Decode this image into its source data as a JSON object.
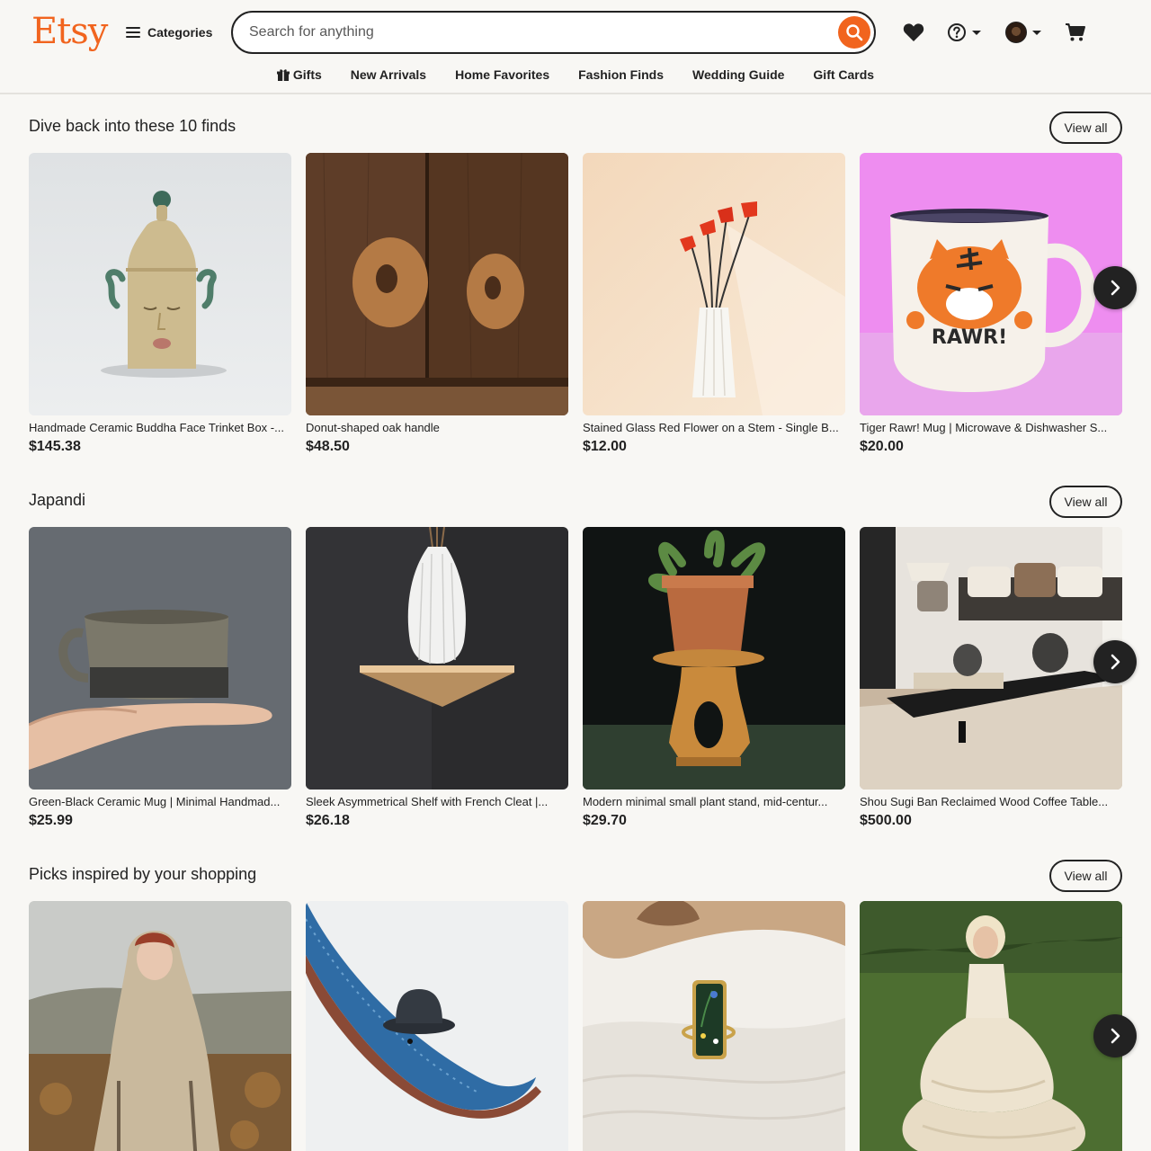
{
  "brand": {
    "logo": "Etsy",
    "accent": "#f1641e"
  },
  "header": {
    "categories_label": "Categories",
    "search_placeholder": "Search for anything"
  },
  "subnav": [
    {
      "label": "Gifts",
      "icon": "gift-icon"
    },
    {
      "label": "New Arrivals"
    },
    {
      "label": "Home Favorites"
    },
    {
      "label": "Fashion Finds"
    },
    {
      "label": "Wedding Guide"
    },
    {
      "label": "Gift Cards"
    }
  ],
  "sections": [
    {
      "title": "Dive back into these 10 finds",
      "view_all": "View all",
      "items": [
        {
          "title": "Handmade Ceramic Buddha Face Trinket Box -...",
          "price": "$145.38",
          "image": "ceramic-face-trinket-box"
        },
        {
          "title": "Donut-shaped oak handle",
          "price": "$48.50",
          "image": "donut-oak-handles"
        },
        {
          "title": "Stained Glass Red Flower on a Stem - Single B...",
          "price": "$12.00",
          "image": "red-glass-flowers-vase"
        },
        {
          "title": "Tiger Rawr! Mug | Microwave & Dishwasher S...",
          "price": "$20.00",
          "image": "tiger-rawr-mug",
          "mug_text": "RAWR!"
        }
      ]
    },
    {
      "title": "Japandi",
      "view_all": "View all",
      "items": [
        {
          "title": "Green-Black Ceramic Mug | Minimal Handmad...",
          "price": "$25.99",
          "image": "ceramic-mug-on-hand"
        },
        {
          "title": "Sleek Asymmetrical Shelf with French Cleat |...",
          "price": "$26.18",
          "image": "white-vase-on-shelf"
        },
        {
          "title": "Modern minimal small plant stand, mid-centur...",
          "price": "$29.70",
          "image": "plant-on-wood-stand"
        },
        {
          "title": "Shou Sugi Ban Reclaimed Wood Coffee Table...",
          "price": "$500.00",
          "image": "living-room-coffee-table"
        }
      ]
    },
    {
      "title": "Picks inspired by your shopping",
      "view_all": "View all",
      "items": [
        {
          "image": "hooded-wool-cloak"
        },
        {
          "image": "blue-whale-bowler-hat-carving"
        },
        {
          "image": "pressed-flower-ring"
        },
        {
          "image": "white-tiered-dress"
        }
      ]
    }
  ]
}
